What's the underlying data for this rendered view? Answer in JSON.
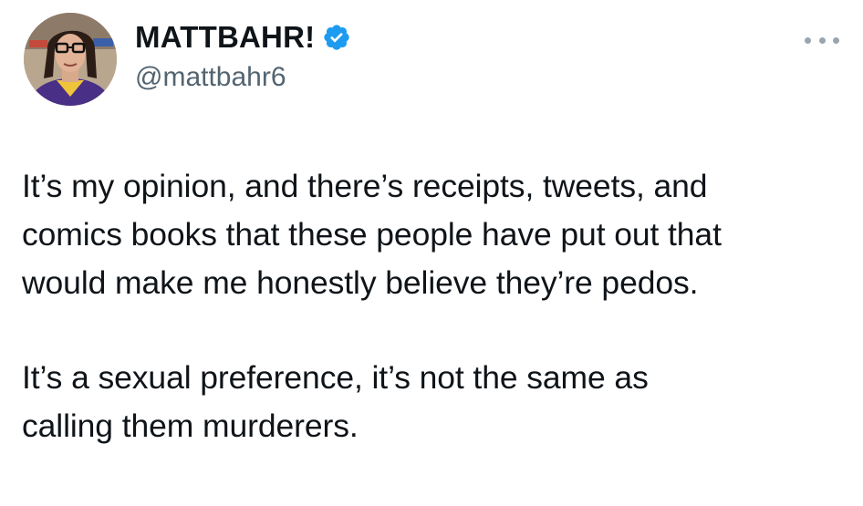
{
  "author": {
    "display_name": "MATTBAHR!",
    "handle": "@mattbahr6",
    "verified": true,
    "avatar_icon": "profile-photo",
    "verified_icon": "verified-badge-icon",
    "verified_color": "#1d9bf0"
  },
  "menu": {
    "icon": "more-options-icon"
  },
  "tweet": {
    "paragraphs": [
      "It’s my opinion, and there’s receipts, tweets, and\ncomics books that these people have put out that\nwould make me honestly believe they’re pedos.",
      "It’s a sexual preference, it’s not the same as\ncalling them murderers."
    ]
  },
  "colors": {
    "text": "#0f1419",
    "secondary_text": "#536471",
    "background": "#ffffff"
  }
}
